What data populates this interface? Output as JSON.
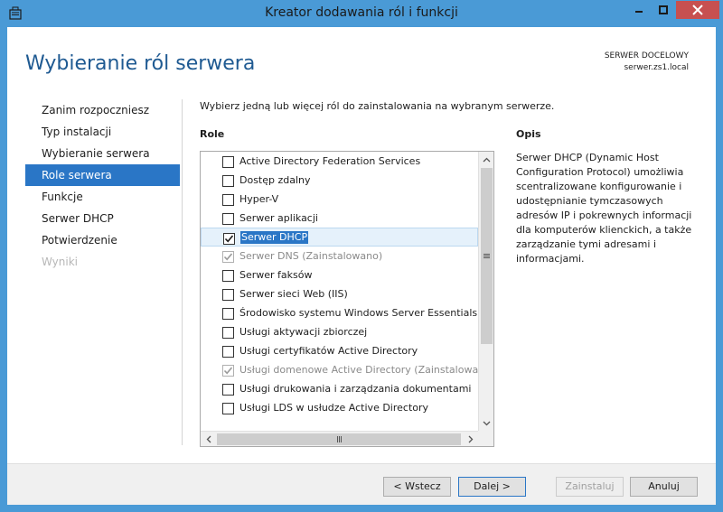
{
  "window": {
    "title": "Kreator dodawania ról i funkcji",
    "icon": "server-manager-icon"
  },
  "header": {
    "page_title": "Wybieranie ról serwera",
    "destination_label": "SERWER DOCELOWY",
    "destination_value": "serwer.zs1.local"
  },
  "nav": {
    "items": [
      {
        "label": "Zanim rozpoczniesz",
        "state": "normal"
      },
      {
        "label": "Typ instalacji",
        "state": "normal"
      },
      {
        "label": "Wybieranie serwera",
        "state": "normal"
      },
      {
        "label": "Role serwera",
        "state": "active"
      },
      {
        "label": "Funkcje",
        "state": "normal"
      },
      {
        "label": "Serwer DHCP",
        "state": "normal"
      },
      {
        "label": "Potwierdzenie",
        "state": "normal"
      },
      {
        "label": "Wyniki",
        "state": "disabled"
      }
    ]
  },
  "main": {
    "instruction": "Wybierz jedną lub więcej ról do zainstalowania na wybranym serwerze.",
    "roles_header": "Role",
    "description_header": "Opis",
    "description_text": "Serwer DHCP (Dynamic Host Configuration Protocol) umożliwia scentralizowane konfigurowanie i udostępnianie tymczasowych adresów IP i pokrewnych informacji dla komputerów klienckich, a także zarządzanie tymi adresami i informacjami.",
    "roles": [
      {
        "label": "Active Directory Federation Services",
        "checked": false,
        "disabled": false,
        "selected": false
      },
      {
        "label": "Dostęp zdalny",
        "checked": false,
        "disabled": false,
        "selected": false
      },
      {
        "label": "Hyper-V",
        "checked": false,
        "disabled": false,
        "selected": false
      },
      {
        "label": "Serwer aplikacji",
        "checked": false,
        "disabled": false,
        "selected": false
      },
      {
        "label": "Serwer DHCP",
        "checked": true,
        "disabled": false,
        "selected": true
      },
      {
        "label": "Serwer DNS (Zainstalowano)",
        "checked": true,
        "disabled": true,
        "selected": false
      },
      {
        "label": "Serwer faksów",
        "checked": false,
        "disabled": false,
        "selected": false
      },
      {
        "label": "Serwer sieci Web (IIS)",
        "checked": false,
        "disabled": false,
        "selected": false
      },
      {
        "label": "Środowisko systemu Windows Server Essentials",
        "checked": false,
        "disabled": false,
        "selected": false
      },
      {
        "label": "Usługi aktywacji zbiorczej",
        "checked": false,
        "disabled": false,
        "selected": false
      },
      {
        "label": "Usługi certyfikatów Active Directory",
        "checked": false,
        "disabled": false,
        "selected": false
      },
      {
        "label": "Usługi domenowe Active Directory (Zainstalowano)",
        "checked": true,
        "disabled": true,
        "selected": false
      },
      {
        "label": "Usługi drukowania i zarządzania dokumentami",
        "checked": false,
        "disabled": false,
        "selected": false
      },
      {
        "label": "Usługi LDS w usłudze Active Directory",
        "checked": false,
        "disabled": false,
        "selected": false
      }
    ]
  },
  "footer": {
    "back_label": "< Wstecz",
    "next_label": "Dalej >",
    "install_label": "Zainstaluj",
    "cancel_label": "Anuluj"
  },
  "colors": {
    "titlebar": "#4a9ad6",
    "accent": "#2a76c6",
    "page_title": "#1f5a92",
    "close_button": "#c75050"
  }
}
